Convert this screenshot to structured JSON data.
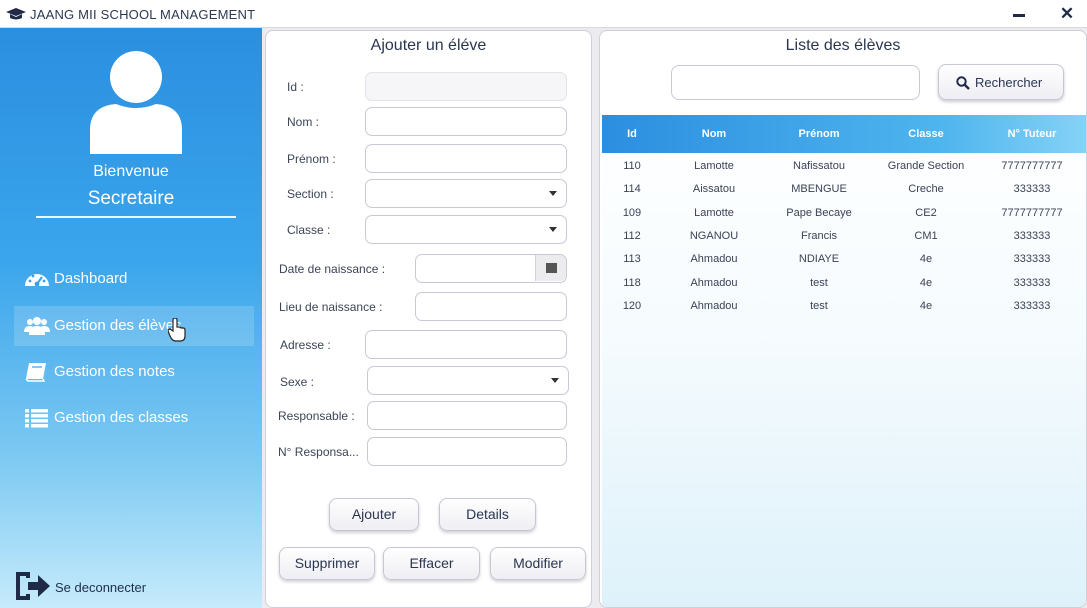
{
  "window": {
    "title": "JAANG MII SCHOOL MANAGEMENT"
  },
  "sidebar": {
    "welcome": "Bienvenue",
    "role": "Secretaire",
    "items": [
      {
        "label": "Dashboard",
        "icon": "dashboard-icon"
      },
      {
        "label": "Gestion des élèves",
        "icon": "users-icon",
        "active": true
      },
      {
        "label": "Gestion des notes",
        "icon": "book-icon"
      },
      {
        "label": "Gestion des classes",
        "icon": "list-icon"
      }
    ],
    "logout": "Se deconnecter"
  },
  "form": {
    "title": "Ajouter un éléve",
    "labels": {
      "id": "Id :",
      "nom": "Nom :",
      "prenom": "Prénom :",
      "section": "Section :",
      "classe": "Classe :",
      "date_naissance": "Date de naissance :",
      "lieu_naissance": "Lieu de naissance :",
      "adresse": "Adresse :",
      "sexe": "Sexe :",
      "responsable": "Responsable :",
      "num_responsable": "N° Responsa..."
    },
    "buttons": {
      "ajouter": "Ajouter",
      "details": "Details",
      "supprimer": "Supprimer",
      "effacer": "Effacer",
      "modifier": "Modifier"
    }
  },
  "list": {
    "title": "Liste des élèves",
    "search_button": "Rechercher",
    "columns": [
      "Id",
      "Nom",
      "Prénom",
      "Classe",
      "N° Tuteur"
    ],
    "rows": [
      [
        "110",
        "Lamotte",
        "Nafissatou",
        "Grande Section",
        "7777777777"
      ],
      [
        "114",
        "Aissatou",
        "MBENGUE",
        "Creche",
        "333333"
      ],
      [
        "109",
        "Lamotte",
        "Pape Becaye",
        "CE2",
        "7777777777"
      ],
      [
        "112",
        "NGANOU",
        "Francis",
        "CM1",
        "333333"
      ],
      [
        "113",
        "Ahmadou",
        "NDIAYE",
        "4e",
        "333333"
      ],
      [
        "118",
        "Ahmadou",
        "test",
        "4e",
        "333333"
      ],
      [
        "120",
        "Ahmadou",
        "test",
        "4e",
        "333333"
      ]
    ]
  },
  "colors": {
    "accent": "#2b8fe0",
    "sidebar_light": "#c6ebfb"
  }
}
